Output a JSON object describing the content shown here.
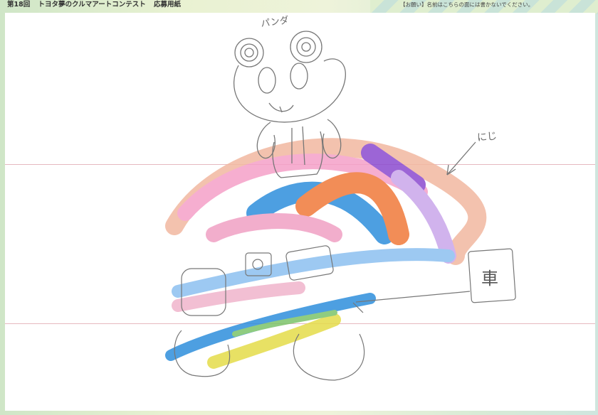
{
  "form": {
    "edition": "第18回",
    "contest_name": "トヨタ夢のクルマアートコンテスト",
    "form_type": "応募用紙",
    "notice": "【お願い】名前はこちらの面には書かないでください。"
  },
  "drawing": {
    "label_panda": "パンダ",
    "label_rainbow": "にじ",
    "label_car": "車"
  },
  "colors": {
    "frame": "#dcecd0",
    "guide_line": "#e6b9bf",
    "pencil": "#777777"
  }
}
